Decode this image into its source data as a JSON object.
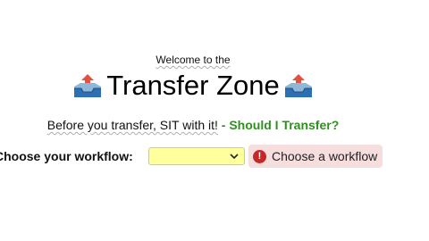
{
  "header": {
    "welcome_text": "Welcome to the",
    "title": "Transfer Zone",
    "title_icon": "outbox-tray-icon"
  },
  "intro": {
    "text": "Before you transfer, SIT with it!",
    "link_text": "- Should I Transfer?",
    "link_color": "#2f8f1f"
  },
  "workflow": {
    "label": "Choose your workflow:",
    "selected_value": "",
    "select_background": "#ffff9e",
    "error_icon": "error-exclamation-icon",
    "error_message": "Choose a workflow",
    "error_background": "#f7dede",
    "error_icon_color": "#c62828"
  }
}
